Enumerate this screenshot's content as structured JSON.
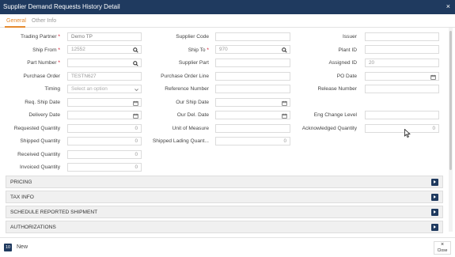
{
  "window": {
    "title": "Supplier Demand Requests History Detail",
    "close_glyph": "×"
  },
  "tabs": [
    {
      "label": "General",
      "active": true
    },
    {
      "label": "Other Info",
      "active": false
    }
  ],
  "form": {
    "trading_partner": {
      "label": "Trading Partner",
      "required_mark": "*",
      "value": "Demo TP"
    },
    "ship_from": {
      "label": "Ship From",
      "required_mark": "*",
      "value": "12552"
    },
    "part_number": {
      "label": "Part Number",
      "required_mark": "*",
      "value": ""
    },
    "purchase_order": {
      "label": "Purchase Order",
      "value": "TESTN627"
    },
    "timing": {
      "label": "Timing",
      "placeholder": "Select an option"
    },
    "req_ship_date": {
      "label": "Req. Ship Date",
      "value": ""
    },
    "delivery_date": {
      "label": "Delivery Date",
      "value": ""
    },
    "requested_quantity": {
      "label": "Requested Quantity",
      "value": "0"
    },
    "shipped_quantity": {
      "label": "Shipped Quantity",
      "value": "0"
    },
    "received_quantity": {
      "label": "Received Quantity",
      "value": "0"
    },
    "invoiced_quantity": {
      "label": "Invoiced Quantity",
      "value": "0"
    },
    "supplier_code": {
      "label": "Supplier Code",
      "value": ""
    },
    "ship_to": {
      "label": "Ship To",
      "required_mark": "*",
      "value": "970"
    },
    "supplier_part": {
      "label": "Supplier Part",
      "value": ""
    },
    "purchase_order_line": {
      "label": "Purchase Order Line",
      "value": ""
    },
    "reference_number": {
      "label": "Reference Number",
      "value": ""
    },
    "our_ship_date": {
      "label": "Our Ship Date",
      "value": ""
    },
    "our_del_date": {
      "label": "Our Del. Date",
      "value": ""
    },
    "unit_of_measure": {
      "label": "Unit of Measure",
      "value": ""
    },
    "shipped_lading_quantity": {
      "label": "Shipped Lading Quant...",
      "value": "0"
    },
    "issuer": {
      "label": "Issuer",
      "value": ""
    },
    "plant_id": {
      "label": "Plant ID",
      "value": ""
    },
    "assigned_id": {
      "label": "Assigned ID",
      "value": "20"
    },
    "po_date": {
      "label": "PO Date",
      "value": ""
    },
    "release_number": {
      "label": "Release Number",
      "value": ""
    },
    "eng_change_level": {
      "label": "Eng Change Level",
      "value": ""
    },
    "acknowledged_quantity": {
      "label": "Acknowledged Quantity",
      "value": "0"
    }
  },
  "sections": [
    {
      "label": "PRICING"
    },
    {
      "label": "TAX INFO"
    },
    {
      "label": "SCHEDULE REPORTED SHIPMENT"
    },
    {
      "label": "AUTHORIZATIONS"
    }
  ],
  "footer": {
    "badge": "10",
    "new_label": "New",
    "close_glyph": "×",
    "close_label": "Close"
  },
  "colors": {
    "header": "#1f3a5f",
    "accent": "#e58a2e",
    "required": "#d0021b"
  },
  "icons": {
    "search": "search-icon",
    "calendar": "calendar-icon",
    "dropdown": "chevron-down-icon",
    "expand": "expand-arrow-icon"
  }
}
